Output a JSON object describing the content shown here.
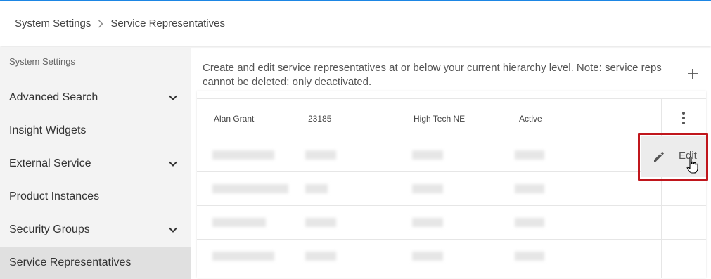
{
  "breadcrumb": {
    "parent": "System Settings",
    "current": "Service Representatives"
  },
  "sidebar": {
    "title": "System Settings",
    "items": [
      {
        "label": "Advanced Search",
        "has_chevron": true
      },
      {
        "label": "Insight Widgets",
        "has_chevron": false
      },
      {
        "label": "External Service",
        "has_chevron": true
      },
      {
        "label": "Product Instances",
        "has_chevron": false
      },
      {
        "label": "Security Groups",
        "has_chevron": true
      },
      {
        "label": "Service Representatives",
        "has_chevron": false,
        "active": true
      }
    ]
  },
  "main": {
    "description": "Create and edit service representatives at or below your current hierarchy level. Note: service reps cannot be deleted; only deactivated.",
    "add_icon": "plus-icon",
    "rows": [
      {
        "name": "Alan Grant",
        "id": "23185",
        "group": "High Tech NE",
        "status": "Active"
      }
    ],
    "row_menu": {
      "edit_label": "Edit",
      "edit_icon": "pencil-icon"
    }
  },
  "colors": {
    "accent_line": "#1e88e5",
    "highlight_box": "#c0161c",
    "sidebar_bg": "#f3f3f3",
    "sidebar_active_bg": "#e0e0e0"
  }
}
